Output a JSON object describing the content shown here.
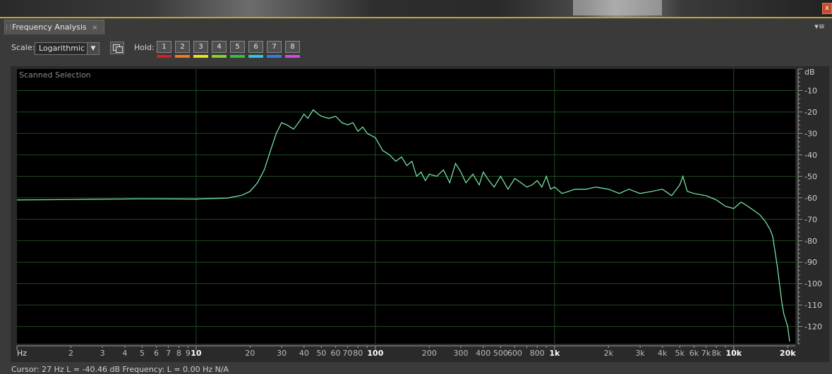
{
  "panel": {
    "tab_title": "Frequency Analysis",
    "tab_close": "×",
    "menu_glyph": "▾≡",
    "close_glyph": "x"
  },
  "toolbar": {
    "scale_label": "Scale:",
    "scale_value": "Logarithmic",
    "hold_label": "Hold:",
    "hold_buttons": [
      {
        "label": "1",
        "color": "#d42020"
      },
      {
        "label": "2",
        "color": "#ee7a18"
      },
      {
        "label": "3",
        "color": "#f0e21a"
      },
      {
        "label": "4",
        "color": "#8ad02a"
      },
      {
        "label": "5",
        "color": "#3fb84a"
      },
      {
        "label": "6",
        "color": "#29c9e0"
      },
      {
        "label": "7",
        "color": "#2f80e0"
      },
      {
        "label": "8",
        "color": "#d24ad8"
      }
    ]
  },
  "plot": {
    "selection_label": "Scanned Selection",
    "db_unit": "dB",
    "hz_unit": "Hz",
    "background": "#000000",
    "grid_color": "#1e4d1e",
    "curve_color": "#7ef0b0"
  },
  "chart_data": {
    "type": "line",
    "title": "",
    "xlabel": "Hz",
    "ylabel": "dB",
    "xscale": "log",
    "xlim": [
      1,
      22050
    ],
    "ylim": [
      -128,
      0
    ],
    "x_ticks": [
      "2",
      "3",
      "4",
      "5",
      "6",
      "7",
      "8",
      "9",
      "10",
      "20",
      "30",
      "40",
      "50",
      "60",
      "70",
      "80",
      "100",
      "200",
      "300",
      "400",
      "500",
      "600",
      "800",
      "1k",
      "2k",
      "3k",
      "4k",
      "5k",
      "6k",
      "7k",
      "8k",
      "10k",
      "20k"
    ],
    "y_ticks": [
      "-10",
      "-20",
      "-30",
      "-40",
      "-50",
      "-60",
      "-70",
      "-80",
      "-90",
      "-100",
      "-110",
      "-120"
    ],
    "grid": true,
    "series": [
      {
        "x": [
          1,
          2,
          5,
          10,
          15,
          18,
          20,
          22,
          24,
          26,
          28,
          30,
          32,
          35,
          38,
          40,
          42,
          45,
          48,
          50,
          55,
          60,
          65,
          70,
          75,
          80,
          85,
          90,
          100,
          110,
          120,
          130,
          140,
          150,
          160,
          170,
          180,
          190,
          200,
          220,
          240,
          260,
          280,
          300,
          320,
          350,
          380,
          400,
          430,
          460,
          500,
          550,
          600,
          650,
          700,
          750,
          800,
          850,
          900,
          950,
          1000,
          1100,
          1200,
          1300,
          1500,
          1700,
          2000,
          2300,
          2600,
          3000,
          3500,
          4000,
          4500,
          5000,
          5200,
          5500,
          6000,
          7000,
          8000,
          9000,
          10000,
          11000,
          12000,
          13000,
          14000,
          15000,
          16000,
          16500,
          17000,
          17500,
          18000,
          18500,
          19000,
          20000,
          20500
        ],
        "y": [
          -61,
          -60.8,
          -60.5,
          -60.6,
          -60.1,
          -58.8,
          -57,
          -53,
          -47,
          -38,
          -30,
          -25,
          -26,
          -28,
          -24,
          -21,
          -23,
          -19,
          -21,
          -22,
          -23,
          -22,
          -25,
          -26,
          -25,
          -29,
          -27,
          -30,
          -32,
          -38,
          -40,
          -43,
          -41,
          -45,
          -43,
          -50,
          -48,
          -52,
          -49,
          -50,
          -47,
          -53,
          -44,
          -48,
          -53,
          -49,
          -54,
          -48,
          -52,
          -55,
          -50,
          -56,
          -51,
          -53,
          -55,
          -54,
          -52,
          -55,
          -50,
          -56,
          -55,
          -58,
          -57,
          -56,
          -56,
          -55,
          -56,
          -58,
          -56,
          -58,
          -57,
          -56,
          -59,
          -54,
          -50,
          -57,
          -58,
          -59,
          -61,
          -64,
          -65,
          -62,
          -64,
          -66,
          -68,
          -71,
          -75,
          -78,
          -85,
          -92,
          -100,
          -108,
          -114,
          -120,
          -127
        ]
      }
    ]
  },
  "status": {
    "cursor_text": "Cursor: 27 Hz  L = -40.46 dB   Frequency: L = 0.00 Hz  N/A"
  }
}
